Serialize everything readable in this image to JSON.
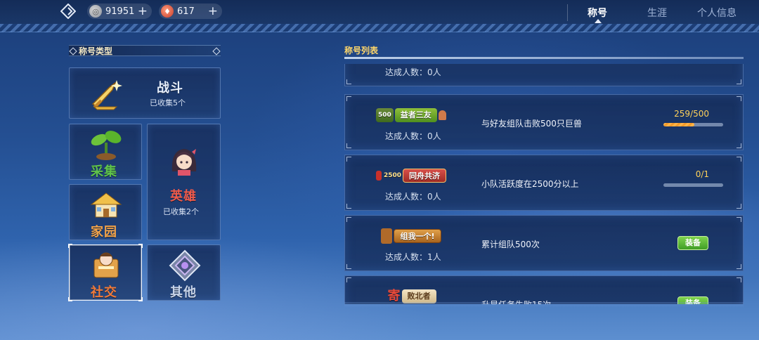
{
  "topbar": {
    "logo_icon": "diamond-logo-icon",
    "currencies": [
      {
        "icon": "silver-coin-icon",
        "value": "91951",
        "plus": "+"
      },
      {
        "icon": "red-crystal-icon",
        "value": "617",
        "plus": "+"
      }
    ],
    "tabs": [
      {
        "label": "称号",
        "active": true
      },
      {
        "label": "生涯",
        "active": false
      },
      {
        "label": "个人信息",
        "active": false
      }
    ]
  },
  "left_panel": {
    "title": "称号类型",
    "categories": [
      {
        "name": "战斗",
        "sub": "已收集5个",
        "color": "#f0a24a",
        "icon": "sword-icon"
      },
      {
        "name": "采集",
        "sub": "",
        "color": "#5fc24a",
        "icon": "sprout-icon"
      },
      {
        "name": "英雄",
        "sub": "已收集2个",
        "color": "#ef5a4a",
        "icon": "hero-portrait-icon"
      },
      {
        "name": "家园",
        "sub": "",
        "color": "#f0a24a",
        "icon": "house-icon"
      },
      {
        "name": "社交",
        "sub": "",
        "color": "#f07a3a",
        "icon": "social-icon",
        "selected": true
      },
      {
        "name": "其他",
        "sub": "",
        "color": "#c8d4e8",
        "icon": "other-gem-icon"
      }
    ]
  },
  "right_panel": {
    "title": "称号列表",
    "rows": [
      {
        "badge": "",
        "achieved": "达成人数：0人",
        "desc": "",
        "progress_text": "",
        "progress": null,
        "button": ""
      },
      {
        "badge": "益者三友",
        "badge_tag": "500",
        "achieved": "达成人数：0人",
        "desc": "与好友组队击败500只巨兽",
        "progress_text": "259/500",
        "progress": 0.518,
        "button": ""
      },
      {
        "badge": "同舟共济",
        "badge_tag": "2500",
        "achieved": "达成人数：0人",
        "desc": "小队活跃度在2500分以上",
        "progress_text": "0/1",
        "progress": 0,
        "button": ""
      },
      {
        "badge": "组我一个!",
        "badge_tag": "",
        "achieved": "达成人数：1人",
        "desc": "累计组队500次",
        "progress_text": "",
        "progress": null,
        "button": "装备"
      },
      {
        "badge": "败北者",
        "badge_tag": "寄",
        "achieved": "",
        "desc": "升星任务失败15次",
        "progress_text": "",
        "progress": null,
        "button": "装备"
      }
    ]
  },
  "colors": {
    "accent_gold": "#ffd25a",
    "equip_green": "#4fb32f"
  }
}
